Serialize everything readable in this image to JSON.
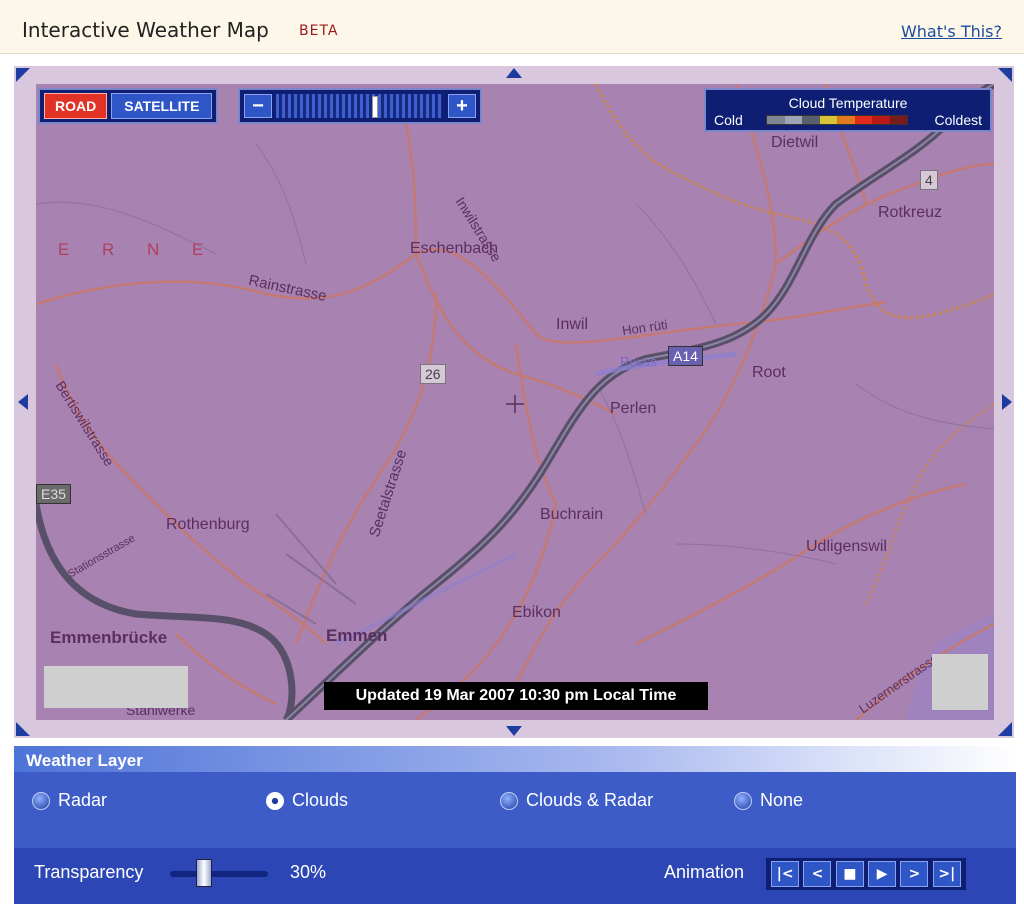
{
  "header": {
    "title": "Interactive Weather Map",
    "badge": "BETA",
    "help_link": "What's This?"
  },
  "map": {
    "mode_buttons": [
      "ROAD",
      "SATELLITE"
    ],
    "active_mode": "ROAD",
    "zoom": {
      "minus": "−",
      "plus": "+",
      "level_fraction": 0.6
    },
    "legend": {
      "title": "Cloud Temperature",
      "low_label": "Cold",
      "high_label": "Coldest",
      "swatch_colors": [
        "#7f8494",
        "#9fa4b6",
        "#5a5f70",
        "#d8c23a",
        "#e07a1f",
        "#e42a1a",
        "#b81818",
        "#7a1a1a"
      ]
    },
    "timestamp": "Updated 19 Mar 2007 10:30 pm Local Time",
    "place_labels": {
      "lucerne": "E R N E",
      "eschenbach": "Eschenbach",
      "dietwil": "Dietwil",
      "rotkreuz": "Rotkreuz",
      "inwil": "Inwil",
      "root": "Root",
      "perlen": "Perlen",
      "rothenburg": "Rothenburg",
      "buchrain": "Buchrain",
      "udligenswil": "Udligenswil",
      "ebikon": "Ebikon",
      "emmenbrucke": "Emmenbrücke",
      "emmen": "Emmen",
      "stahlwerke": "Stahlwerke",
      "honrüti": "Hon rüti",
      "reuss": "Reuss"
    },
    "street_labels": {
      "inwilstrasse": "Inwilstrasse",
      "rainstrasse": "Rainstrasse",
      "bertiswilstrasse": "Bertiswilstrasse",
      "seetalstrasse": "Seetalstrasse",
      "stationsstrasse": "Stationsstrasse",
      "luzernerstrasse": "Luzernerstrasse"
    },
    "route_markers": {
      "r26": "26",
      "r4": "4",
      "a14": "A14",
      "e35": "E35"
    }
  },
  "weather_layer": {
    "heading": "Weather Layer",
    "options": [
      "Radar",
      "Clouds",
      "Clouds & Radar",
      "None"
    ],
    "selected": "Clouds"
  },
  "transparency": {
    "label": "Transparency",
    "value": "30%"
  },
  "animation": {
    "label": "Animation",
    "controls": [
      "first",
      "prev",
      "stop",
      "play",
      "next",
      "last"
    ]
  }
}
